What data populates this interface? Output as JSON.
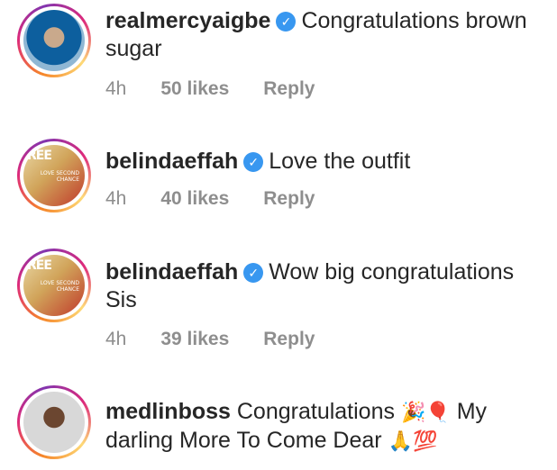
{
  "comments": [
    {
      "username": "realmercyaigbe",
      "verified": true,
      "text": "Congratulations brown sugar",
      "time": "4h",
      "likes": "50 likes",
      "reply": "Reply"
    },
    {
      "username": "belindaeffah",
      "verified": true,
      "text": "Love the outfit",
      "time": "4h",
      "likes": "40 likes",
      "reply": "Reply"
    },
    {
      "username": "belindaeffah",
      "verified": true,
      "text": "Wow big congratulations Sis",
      "time": "4h",
      "likes": "39 likes",
      "reply": "Reply"
    },
    {
      "username": "medlinboss",
      "verified": false,
      "text_part1": "Congratulations",
      "emoji1": "🎉🎈",
      "text_part2": "My darling More To Come Dear",
      "emoji2": "🙏💯"
    }
  ],
  "avatar_labels": {
    "belinda_mag": "REE",
    "belinda_cover": "LOVE SECOND CHANCE"
  },
  "colors": {
    "verified": "#3897f0",
    "meta_text": "#8e8e8e",
    "text": "#262626"
  }
}
